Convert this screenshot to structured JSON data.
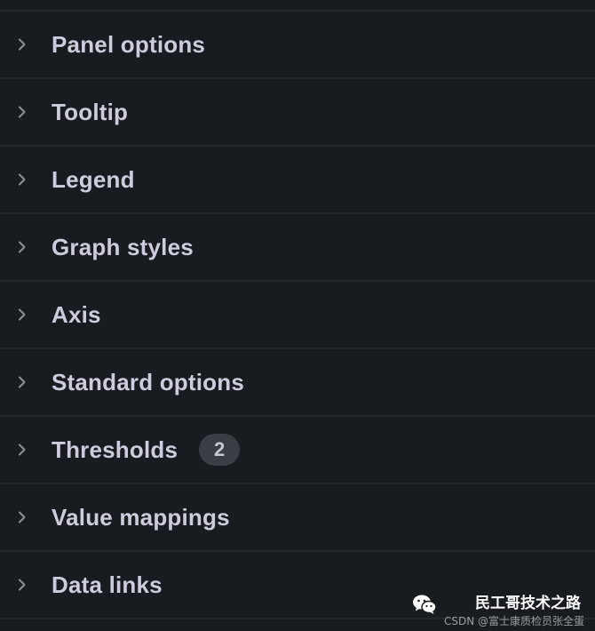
{
  "sections": [
    {
      "label": "Panel options"
    },
    {
      "label": "Tooltip"
    },
    {
      "label": "Legend"
    },
    {
      "label": "Graph styles"
    },
    {
      "label": "Axis"
    },
    {
      "label": "Standard options"
    },
    {
      "label": "Thresholds",
      "badge": "2"
    },
    {
      "label": "Value mappings"
    },
    {
      "label": "Data links"
    }
  ],
  "icons": {
    "collapsed": "chevron-right-icon",
    "watermark": "wechat-icon"
  },
  "watermark": {
    "title": "民工哥技术之路",
    "subtitle": "CSDN @富士康质检员张全蛋"
  },
  "colors": {
    "background": "#181b1f",
    "divider": "#23262c",
    "label": "#ccccdc",
    "badge_bg": "#3a3d43"
  }
}
